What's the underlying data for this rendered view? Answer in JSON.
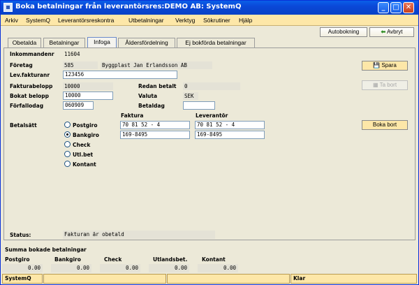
{
  "window": {
    "title": "Boka betalningar från leverantörsres:DEMO AB: SystemQ"
  },
  "menu": [
    "Arkiv",
    "SystemQ",
    "Leverantörsreskontra",
    "Utbetalningar",
    "Verktyg",
    "Sökrutiner",
    "Hjälp"
  ],
  "toolbar": {
    "autobokning": "Autobokning",
    "avbryt": "Avbryt"
  },
  "tabs": [
    "Obetalda",
    "Betalningar",
    "Infoga",
    "Åldersfördelning",
    "Ej bokförda betalningar"
  ],
  "form": {
    "inkommandenr_label": "Inkommandenr",
    "inkommandenr": "11604",
    "foretag_label": "Företag",
    "foretag_nr": "585",
    "foretag_namn": "Byggplast Jan Erlandsson AB",
    "levfakturanr_label": "Lev.fakturanr",
    "levfakturanr": "123456",
    "fakturabelopp_label": "Fakturabelopp",
    "fakturabelopp": "10000",
    "redan_betalt_label": "Redan betalt",
    "redan_betalt": "0",
    "bokat_belopp_label": "Bokat belopp",
    "bokat_belopp": "10000",
    "valuta_label": "Valuta",
    "valuta": "SEK",
    "forfallodag_label": "Förfallodag",
    "forfallodag": "060909",
    "betaldag_label": "Betaldag",
    "betaldag": "",
    "betalsatt_label": "Betalsätt",
    "faktura_label": "Faktura",
    "leverantor_label": "Leverantör",
    "faktura_postgiro": "70 81 52 - 4",
    "faktura_bankgiro": "169-8495",
    "lev_postgiro": "70 81 52 - 4",
    "lev_bankgiro": "169-8495",
    "payment_options": [
      "Postgiro",
      "Bankgiro",
      "Check",
      "Utl.bet",
      "Kontant"
    ],
    "selected_option": "Bankgiro",
    "status_label": "Status:",
    "status": "Fakturan är obetald"
  },
  "side_buttons": {
    "spara": "Spara",
    "ta_bort": "Ta bort",
    "boka_bort": "Boka bort"
  },
  "summary": {
    "title": "Summa bokade betalningar",
    "columns": [
      {
        "label": "Postgiro",
        "value": "0.00"
      },
      {
        "label": "Bankgiro",
        "value": "0.00"
      },
      {
        "label": "Check",
        "value": "0.00"
      },
      {
        "label": "Utlandsbet.",
        "value": "0.00"
      },
      {
        "label": "Kontant",
        "value": "0.00"
      }
    ]
  },
  "statusbar": {
    "left": "SystemQ",
    "right": "Klar"
  },
  "colors": {
    "menubar": "#FDE7A8",
    "titlebar": "#0A48D8",
    "panel": "#ECE9D8"
  }
}
